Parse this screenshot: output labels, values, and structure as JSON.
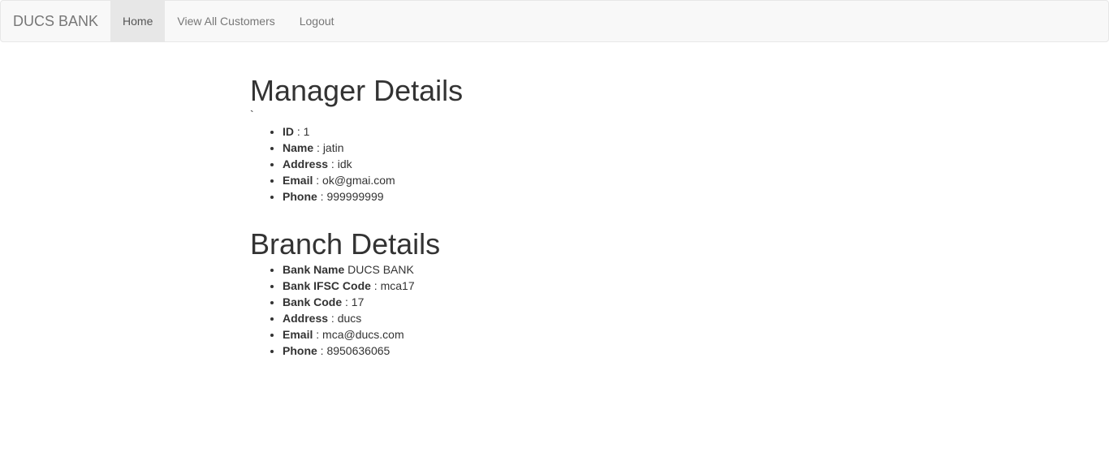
{
  "navbar": {
    "brand": "DUCS BANK",
    "items": [
      {
        "label": "Home",
        "active": true
      },
      {
        "label": "View All Customers",
        "active": false
      },
      {
        "label": "Logout",
        "active": false
      }
    ]
  },
  "manager": {
    "title": "Manager Details",
    "stray_char": "`",
    "fields": [
      {
        "label": "ID",
        "sep": " : ",
        "value": "1"
      },
      {
        "label": "Name",
        "sep": " : ",
        "value": "jatin"
      },
      {
        "label": "Address",
        "sep": " : ",
        "value": "idk"
      },
      {
        "label": "Email",
        "sep": " : ",
        "value": "ok@gmai.com"
      },
      {
        "label": "Phone",
        "sep": " : ",
        "value": "999999999"
      }
    ]
  },
  "branch": {
    "title": "Branch Details",
    "fields": [
      {
        "label": "Bank Name",
        "sep": " ",
        "value": "DUCS BANK"
      },
      {
        "label": "Bank IFSC Code",
        "sep": " : ",
        "value": "mca17"
      },
      {
        "label": "Bank Code",
        "sep": " : ",
        "value": "17"
      },
      {
        "label": "Address",
        "sep": " : ",
        "value": "ducs"
      },
      {
        "label": "Email",
        "sep": " : ",
        "value": "mca@ducs.com"
      },
      {
        "label": "Phone",
        "sep": " : ",
        "value": "8950636065"
      }
    ]
  },
  "colors": {
    "navbar_bg": "#f8f8f8",
    "navbar_border": "#e7e7e7",
    "active_bg": "#e7e7e7",
    "nav_text": "#777777",
    "body_text": "#333333"
  }
}
